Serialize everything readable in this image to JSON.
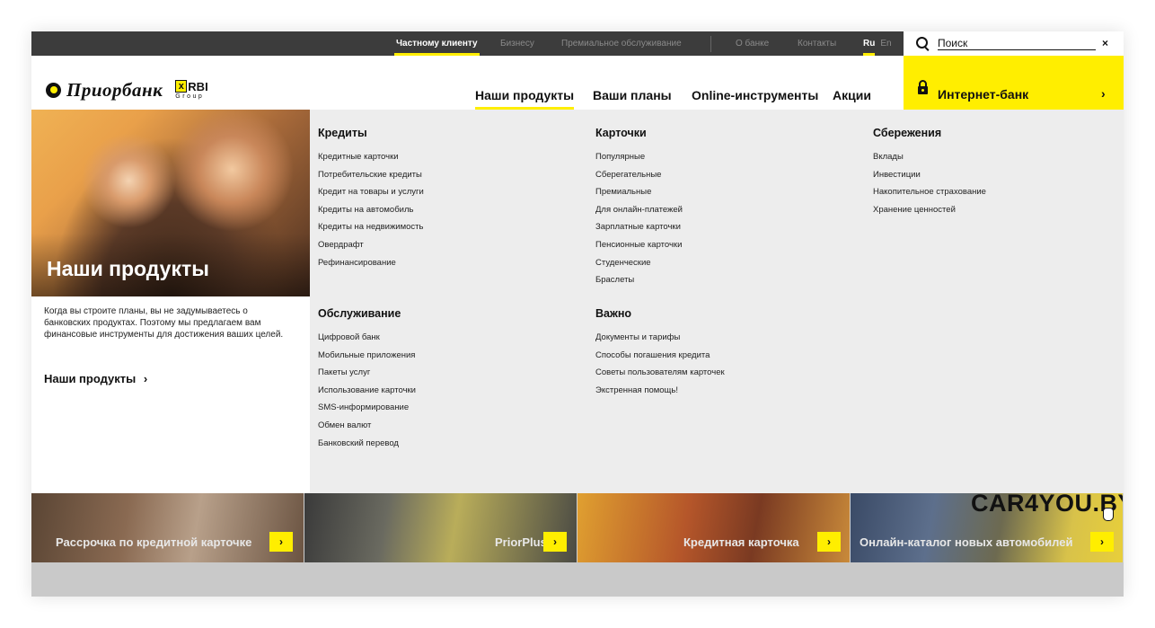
{
  "topbar": {
    "nav": [
      {
        "label": "Частному клиенту",
        "active": true
      },
      {
        "label": "Бизнесу",
        "active": false
      },
      {
        "label": "Премиальное обслуживание",
        "active": false
      },
      {
        "label": "О банке",
        "active": false
      },
      {
        "label": "Контакты",
        "active": false
      }
    ],
    "lang_ru": "Ru",
    "lang_en": "En",
    "search_placeholder": "Поиск",
    "close_icon": "×"
  },
  "header": {
    "logo_text": "Приорбанк",
    "rbi_mark": "RBI",
    "rbi_group": "Group",
    "nav": [
      {
        "label": "Наши продукты",
        "active": true
      },
      {
        "label": "Ваши планы",
        "active": false
      },
      {
        "label": "Online-инструменты",
        "active": false
      },
      {
        "label": "Акции",
        "active": false
      }
    ],
    "internet_bank": "Интернет-банк",
    "internet_bank_arrow": "›"
  },
  "left_panel": {
    "hero_title": "Наши продукты",
    "description": "Когда вы строите планы, вы не задумываетесь о банковских продуктах. Поэтому мы предлагаем вам финансовые инструменты для достижения ваших целей.",
    "link_label": "Наши продукты",
    "link_arrow": "›"
  },
  "menu": {
    "credits": {
      "title": "Кредиты",
      "items": [
        "Кредитные карточки",
        "Потребительские кредиты",
        "Кредит на товары и услуги",
        "Кредиты на автомобиль",
        "Кредиты на недвижимость",
        "Овердрафт",
        "Рефинансирование"
      ]
    },
    "cards": {
      "title": "Карточки",
      "items": [
        "Популярные",
        "Сберегательные",
        "Премиальные",
        "Для онлайн-платежей",
        "Зарплатные карточки",
        "Пенсионные карточки",
        "Студенческие",
        "Браслеты"
      ]
    },
    "savings": {
      "title": "Сбережения",
      "items": [
        "Вклады",
        "Инвестиции",
        "Накопительное страхование",
        "Хранение ценностей"
      ]
    },
    "service": {
      "title": "Обслуживание",
      "items": [
        "Цифровой банк",
        "Мобильные приложения",
        "Пакеты услуг",
        "Использование карточки",
        "SMS-информирование",
        "Обмен валют",
        "Банковский перевод"
      ]
    },
    "important": {
      "title": "Важно",
      "items": [
        "Документы и тарифы",
        "Способы погашения кредита",
        "Советы пользователям карточек",
        "Экстренная помощь!"
      ]
    }
  },
  "tiles": [
    {
      "label": "Рассрочка по кредитной карточке",
      "arrow": "›"
    },
    {
      "label": "PriorPlus",
      "arrow": "›"
    },
    {
      "label": "Кредитная карточка",
      "arrow": "›"
    },
    {
      "label": "Онлайн-каталог новых автомобилей",
      "arrow": "›",
      "brand": "CAR4YOU.BY"
    }
  ],
  "colors": {
    "accent": "#ffee00",
    "topbar": "#3c3c3c",
    "menu_bg": "#ededed"
  }
}
